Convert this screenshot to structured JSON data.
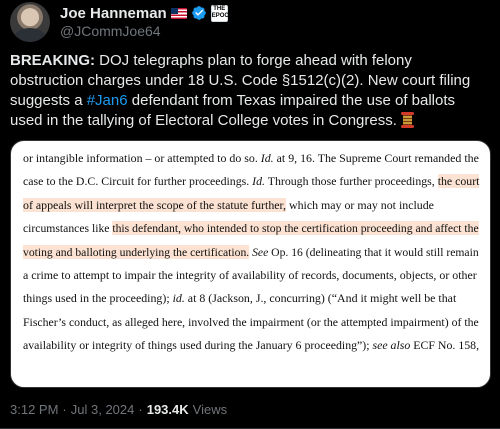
{
  "author": {
    "display_name": "Joe Hanneman",
    "handle": "@JCommJoe64",
    "flag_icon": "us-flag-icon",
    "verified_icon": "verified-badge-icon",
    "affiliate_badge": "THE EPOCH TIMES"
  },
  "tweet": {
    "lead_bold": "BREAKING:",
    "text_part1": " DOJ telegraphs plan to forge ahead with felony obstruction charges under 18 U.S. Code §1512(c)(2). New court filing suggests a ",
    "hashtag": "#Jan6",
    "text_part2": " defendant from Texas impaired the use of ballots used in the tallying of Electoral College votes in Congress.",
    "emoji": "scroll-emoji"
  },
  "document": {
    "lines": [
      [
        {
          "t": "or intangible information – or attempted to do so. "
        },
        {
          "t": "Id.",
          "i": true
        },
        {
          "t": " at 9, 16. The Supreme Court remanded the"
        }
      ],
      [
        {
          "t": "case to the D.C. Circuit for further proceedings. "
        },
        {
          "t": "Id.",
          "i": true
        },
        {
          "t": " Through those further proceedings, "
        },
        {
          "t": "the court",
          "h": true
        }
      ],
      [
        {
          "t": "of appeals will interpret the scope of the statute further,",
          "h": true
        },
        {
          "t": " which may or may not include"
        }
      ],
      [
        {
          "t": "circumstances like "
        },
        {
          "t": "this defendant, who intended to stop the certification proceeding and affect the",
          "h": true
        }
      ],
      [
        {
          "t": "voting and balloting underlying the certification.",
          "h": true
        },
        {
          "t": " "
        },
        {
          "t": "See",
          "i": true
        },
        {
          "t": " Op. 16 (delineating that it would still remain"
        }
      ],
      [
        {
          "t": "a crime to attempt to impair the integrity of availability of records, documents, objects, or other"
        }
      ],
      [
        {
          "t": "things used in the proceeding); "
        },
        {
          "t": "id.",
          "i": true
        },
        {
          "t": " at 8 (Jackson, J., concurring) (“And it might well be that"
        }
      ],
      [
        {
          "t": "Fischer’s conduct, as alleged here, involved the impairment (or the attempted impairment) of the"
        }
      ],
      [
        {
          "t": "availability or integrity of things used during the January 6 proceeding”); "
        },
        {
          "t": "see also",
          "i": true
        },
        {
          "t": " ECF No. 158,"
        }
      ]
    ]
  },
  "meta": {
    "time": "3:12 PM",
    "separator": "·",
    "date": "Jul 3, 2024",
    "views_count": "193.4K",
    "views_label": "Views"
  },
  "colors": {
    "background": "#000000",
    "text": "#e7e9ea",
    "muted": "#71767b",
    "link": "#1d9bf0",
    "highlight": "#fbe2d2"
  }
}
